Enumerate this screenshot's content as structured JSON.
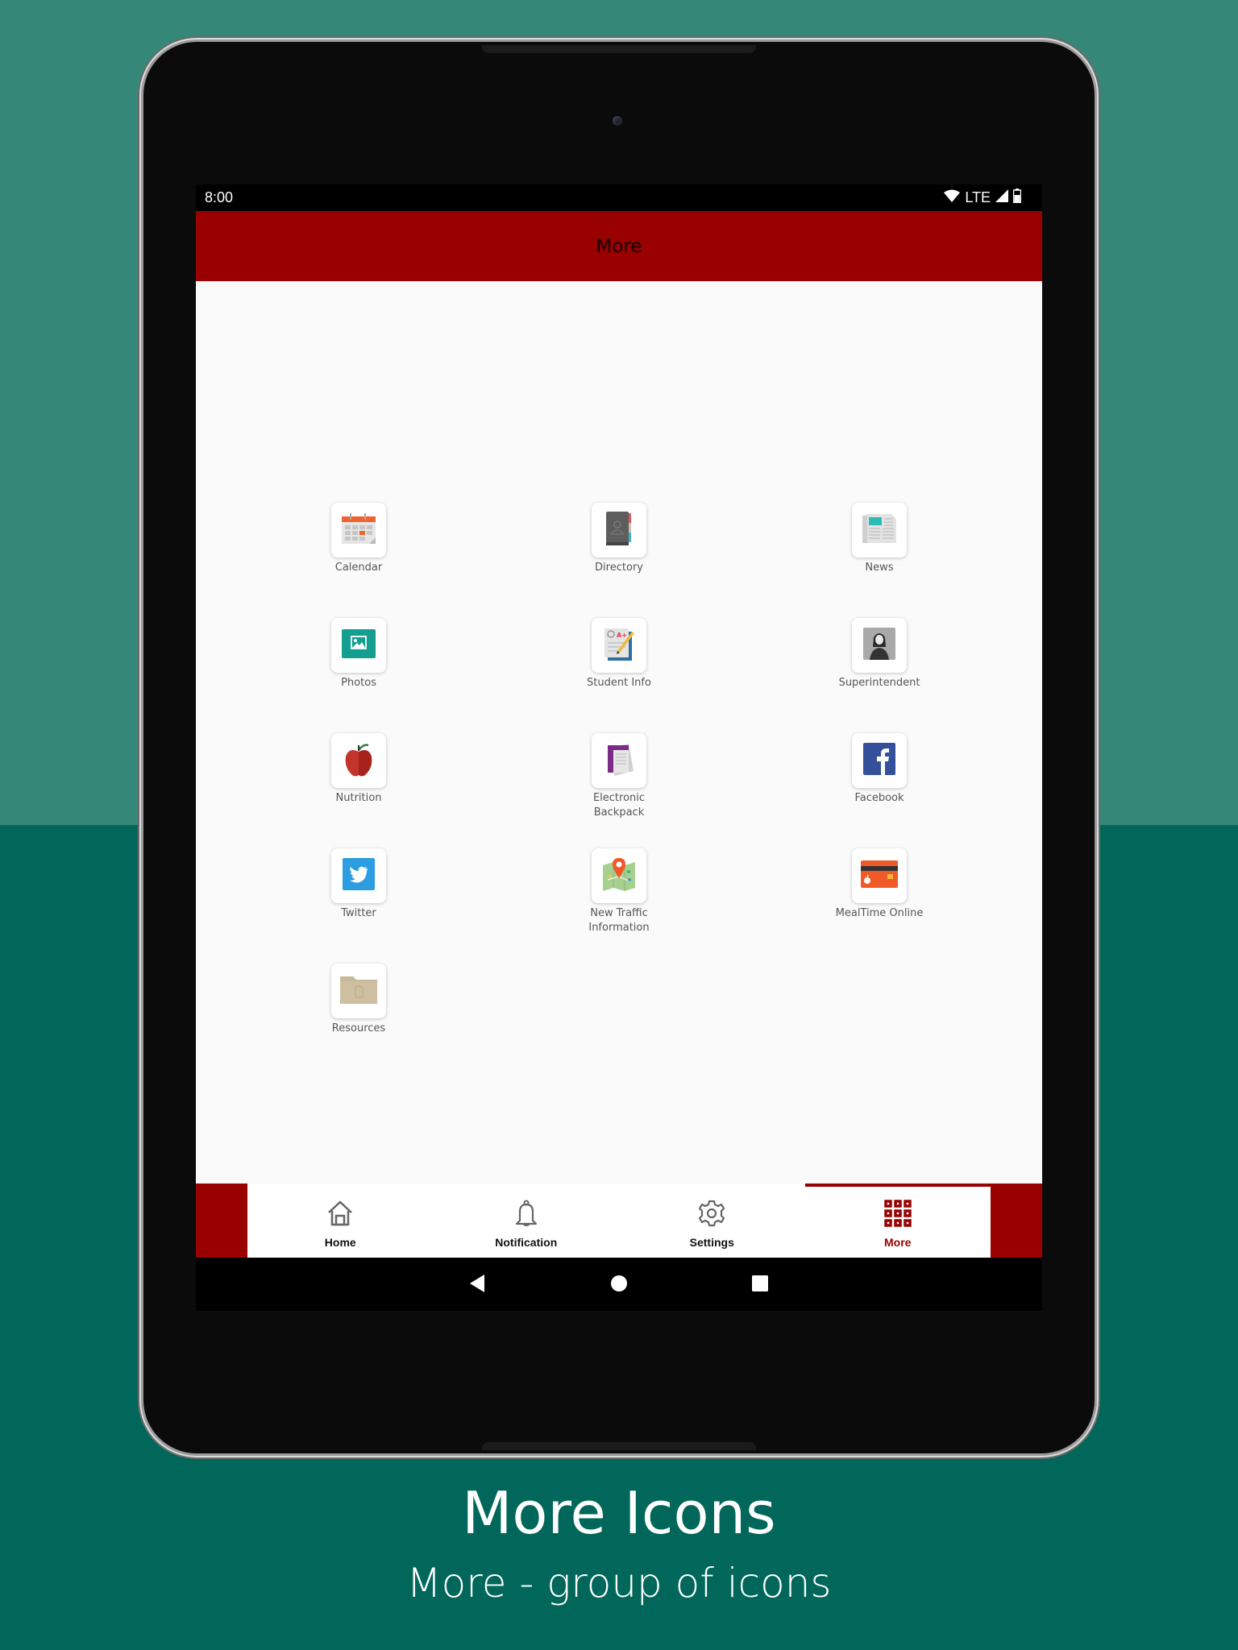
{
  "status_bar": {
    "time": "8:00",
    "network": "LTE",
    "icons": [
      "wifi-icon",
      "signal-icon",
      "battery-icon"
    ]
  },
  "app_bar": {
    "title": "More"
  },
  "tiles": [
    {
      "label": "Calendar",
      "icon": "calendar-icon"
    },
    {
      "label": "Directory",
      "icon": "directory-book-icon"
    },
    {
      "label": "News",
      "icon": "newspaper-icon"
    },
    {
      "label": "Photos",
      "icon": "photo-icon"
    },
    {
      "label": "Student Info",
      "icon": "student-info-icon"
    },
    {
      "label": "Superintendent",
      "icon": "person-icon"
    },
    {
      "label": "Nutrition",
      "icon": "apple-icon"
    },
    {
      "label": "Electronic\nBackpack",
      "icon": "documents-icon"
    },
    {
      "label": "Facebook",
      "icon": "facebook-icon"
    },
    {
      "label": "Twitter",
      "icon": "twitter-icon"
    },
    {
      "label": "New Traffic\nInformation",
      "icon": "map-pin-icon"
    },
    {
      "label": "MealTime Online",
      "icon": "credit-card-icon"
    },
    {
      "label": "Resources",
      "icon": "folder-icon"
    }
  ],
  "bottom_nav": {
    "items": [
      {
        "label": "Home",
        "icon": "home-icon",
        "active": false
      },
      {
        "label": "Notification",
        "icon": "bell-icon",
        "active": false
      },
      {
        "label": "Settings",
        "icon": "gear-icon",
        "active": false
      },
      {
        "label": "More",
        "icon": "grid-icon",
        "active": true
      }
    ]
  },
  "colors": {
    "brand": "#990000",
    "bg_top": "#358878",
    "bg_bottom": "#00675a"
  },
  "caption": {
    "title": "More Icons",
    "subtitle": "More - group of icons"
  }
}
